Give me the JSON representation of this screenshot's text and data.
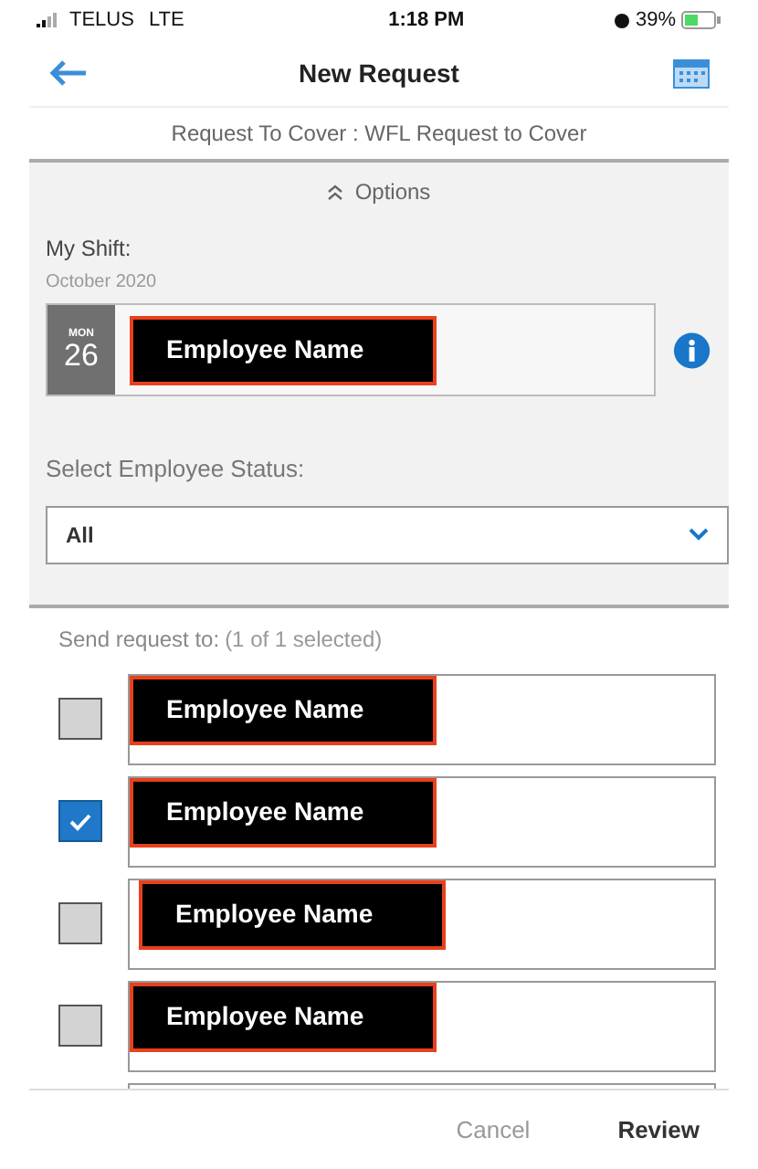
{
  "status_bar": {
    "carrier": "TELUS",
    "network": "LTE",
    "time": "1:18 PM",
    "battery": "39%"
  },
  "header": {
    "title": "New Request"
  },
  "subtitle": "Request To Cover : WFL Request to Cover",
  "options": {
    "toggle": "Options",
    "expanded": true,
    "shift_label": "My Shift:",
    "shift_month": "October 2020",
    "shift_day_name": "MON",
    "shift_day": "26",
    "shift_employee": "Employee Name",
    "status_label": "Select Employee Status:",
    "status_value": "All"
  },
  "recipients": {
    "label": "Send request to:",
    "count": "(1 of 1 selected)",
    "items": [
      {
        "name": "Employee Name",
        "checked": false
      },
      {
        "name": "Employee Name",
        "checked": true
      },
      {
        "name": "Employee Name",
        "checked": false
      },
      {
        "name": "Employee Name",
        "checked": false
      }
    ]
  },
  "footer": {
    "cancel": "Cancel",
    "review": "Review"
  }
}
